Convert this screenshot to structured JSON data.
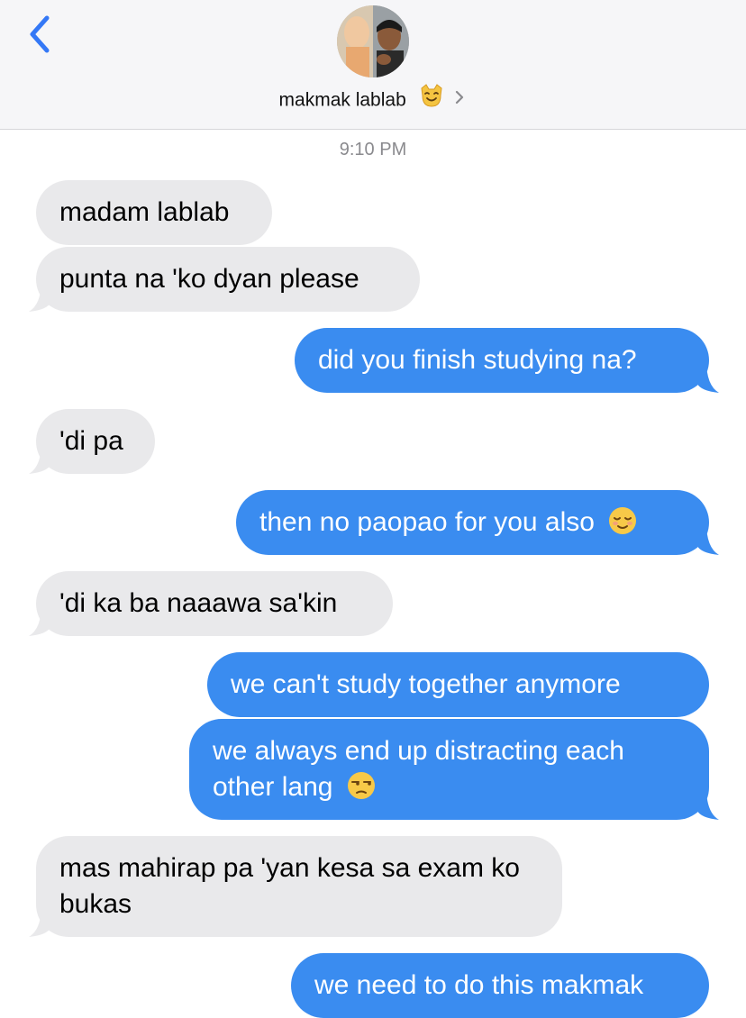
{
  "header": {
    "contact_name": "makmak lablab",
    "contact_emoji": "cat-face-icon",
    "back_icon": "chevron-left-icon",
    "chevron_icon": "chevron-right-icon"
  },
  "conversation": {
    "timestamp": "9:10 PM",
    "messages": [
      {
        "dir": "in",
        "text": "madam lablab"
      },
      {
        "dir": "in",
        "text": "punta na 'ko dyan please"
      },
      {
        "dir": "out",
        "text": "did you finish studying na?"
      },
      {
        "dir": "in",
        "text": "'di pa"
      },
      {
        "dir": "out",
        "text": "then no paopao for you also",
        "emoji": "relieved-face-icon"
      },
      {
        "dir": "in",
        "text": "'di ka ba naaawa sa'kin"
      },
      {
        "dir": "out",
        "text": "we can't study together anymore"
      },
      {
        "dir": "out",
        "text": "we always end up distracting each other lang",
        "emoji": "unamused-face-icon"
      },
      {
        "dir": "in",
        "text": "mas mahirap pa 'yan kesa sa exam ko bukas"
      },
      {
        "dir": "out",
        "text": "we need to do this makmak"
      }
    ]
  },
  "colors": {
    "incoming_bubble": "#e9e9eb",
    "outgoing_bubble": "#3a8cf0",
    "accent": "#3478f6"
  }
}
